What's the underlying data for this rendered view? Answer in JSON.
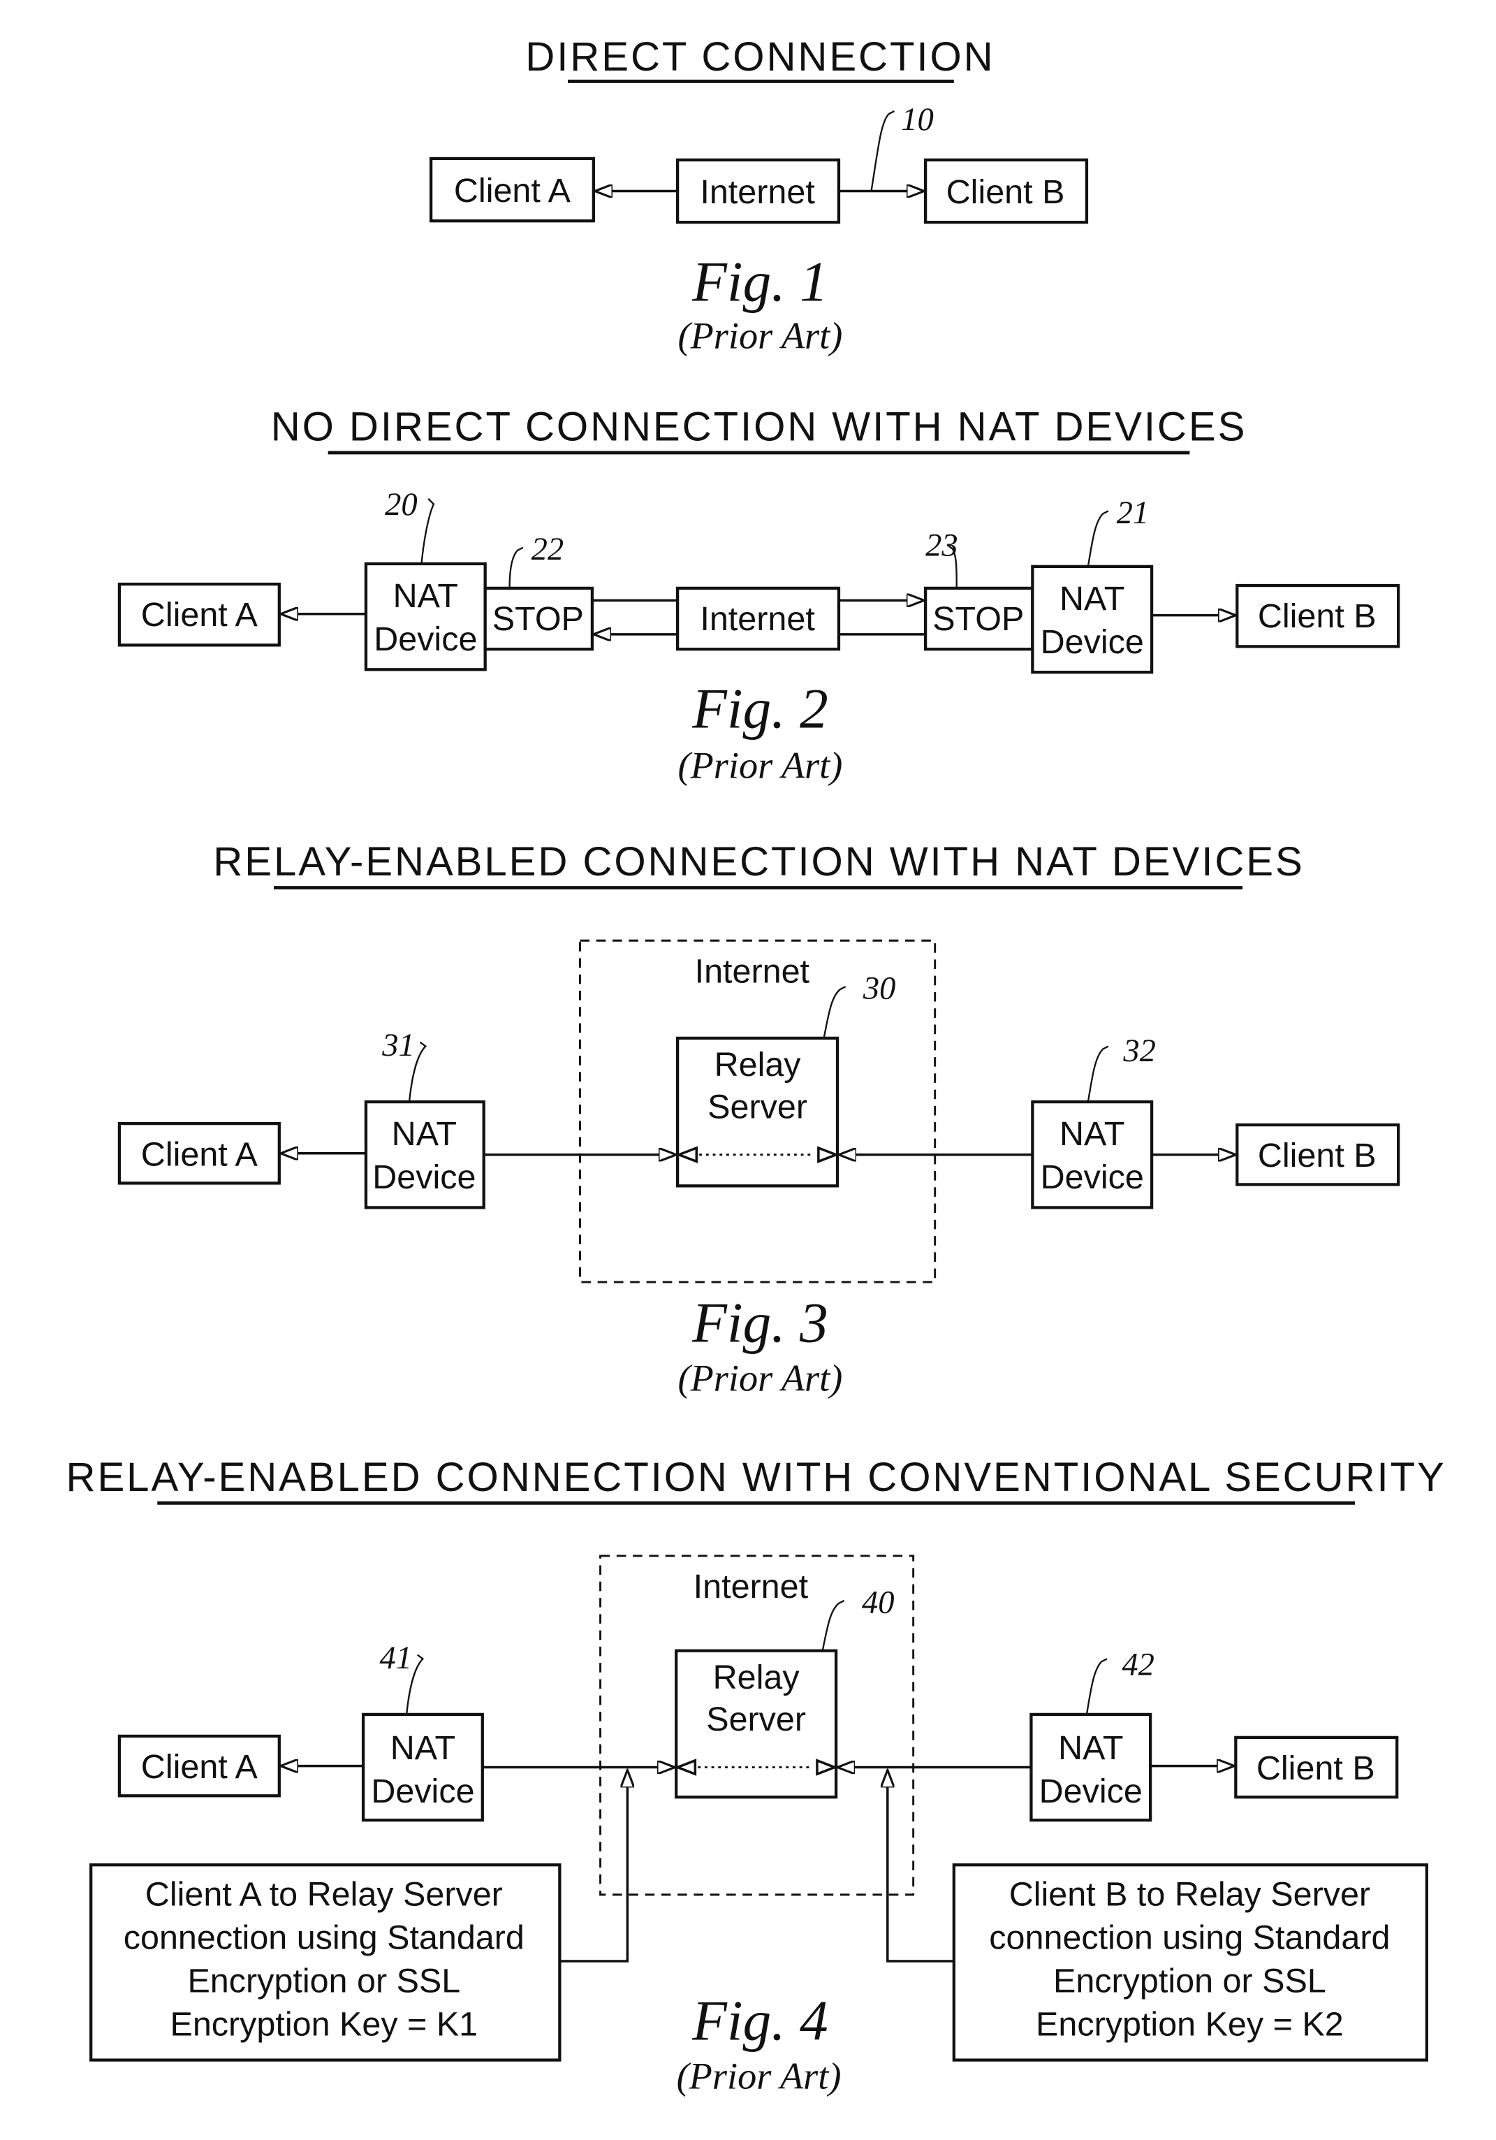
{
  "figures": [
    {
      "id": "fig1",
      "title": "DIRECT CONNECTION",
      "caption": "Fig. 1",
      "subcaption": "(Prior Art)",
      "nodes": {
        "client_a": "Client A",
        "internet": "Internet",
        "client_b": "Client B"
      },
      "refs": {
        "connection": "10"
      }
    },
    {
      "id": "fig2",
      "title": "NO DIRECT CONNECTION WITH NAT DEVICES",
      "caption": "Fig. 2",
      "subcaption": "(Prior Art)",
      "nodes": {
        "client_a": "Client A",
        "nat_a_line1": "NAT",
        "nat_a_line2": "Device",
        "stop_a": "STOP",
        "internet": "Internet",
        "stop_b": "STOP",
        "nat_b_line1": "NAT",
        "nat_b_line2": "Device",
        "client_b": "Client B"
      },
      "refs": {
        "nat_a": "20",
        "nat_b": "21",
        "stop_a": "22",
        "stop_b": "23"
      }
    },
    {
      "id": "fig3",
      "title": "RELAY-ENABLED CONNECTION WITH NAT DEVICES",
      "caption": "Fig. 3",
      "subcaption": "(Prior Art)",
      "nodes": {
        "client_a": "Client A",
        "nat_a_line1": "NAT",
        "nat_a_line2": "Device",
        "internet": "Internet",
        "relay_line1": "Relay",
        "relay_line2": "Server",
        "nat_b_line1": "NAT",
        "nat_b_line2": "Device",
        "client_b": "Client B"
      },
      "refs": {
        "relay": "30",
        "nat_a": "31",
        "nat_b": "32"
      }
    },
    {
      "id": "fig4",
      "title": "RELAY-ENABLED CONNECTION WITH CONVENTIONAL SECURITY",
      "caption": "Fig. 4",
      "subcaption": "(Prior Art)",
      "nodes": {
        "client_a": "Client A",
        "nat_a_line1": "NAT",
        "nat_a_line2": "Device",
        "internet": "Internet",
        "relay_line1": "Relay",
        "relay_line2": "Server",
        "nat_b_line1": "NAT",
        "nat_b_line2": "Device",
        "client_b": "Client B"
      },
      "notes": {
        "a": [
          "Client A to Relay Server",
          "connection using Standard",
          "Encryption or SSL",
          "Encryption Key = K1"
        ],
        "b": [
          "Client B to Relay Server",
          "connection using Standard",
          "Encryption or SSL",
          "Encryption Key = K2"
        ]
      },
      "refs": {
        "relay": "40",
        "nat_a": "41",
        "nat_b": "42"
      }
    }
  ]
}
